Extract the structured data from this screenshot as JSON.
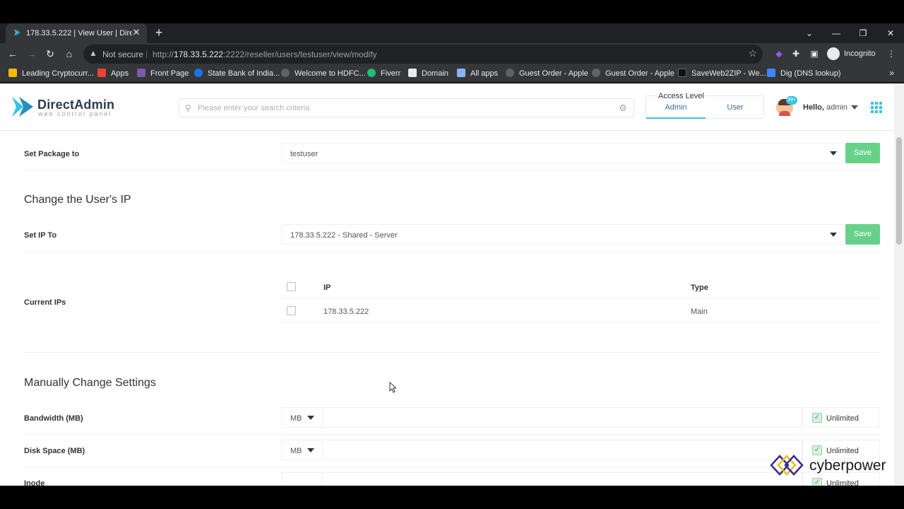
{
  "browser": {
    "tab_title": "178.33.5.222 | View User | DirectA",
    "url_host": "178.33.5.222",
    "url_prefix": "http://",
    "url_rest": ":2222/reseller/users/testuser/view/modify",
    "not_secure": "Not secure",
    "incognito": "Incognito",
    "bookmarks": [
      {
        "label": "Leading Cryptocurr...",
        "color": "#f0b90b"
      },
      {
        "label": "Apps",
        "color": "#ea4335"
      },
      {
        "label": "Front Page",
        "color": "#7a5ba8"
      },
      {
        "label": "State Bank of India...",
        "color": "#1a73e8"
      },
      {
        "label": "Welcome to HDFC...",
        "color": "#5f6368"
      },
      {
        "label": "Fiverr",
        "color": "#1dbf73"
      },
      {
        "label": "Domain",
        "color": "#e8eaed"
      },
      {
        "label": "All apps",
        "color": "#8ab4f8"
      },
      {
        "label": "Guest Order - Apple",
        "color": "#5f6368"
      },
      {
        "label": "Guest Order - Apple",
        "color": "#5f6368"
      },
      {
        "label": "SaveWeb2ZIP - We...",
        "color": "#202124"
      },
      {
        "label": "Dig (DNS lookup)",
        "color": "#4285f4"
      }
    ]
  },
  "header": {
    "brand": "DirectAdmin",
    "brand_sub": "web control panel",
    "search_placeholder": "Please enter your search criteria",
    "access_level_title": "Access Level",
    "access_tabs": [
      "Admin",
      "User"
    ],
    "active_access": "Admin",
    "notification_count": "99+",
    "hello_prefix": "Hello,",
    "username": "admin",
    "accent_color": "#3ac3e1"
  },
  "package": {
    "label": "Set Package to",
    "value": "testuser",
    "save_label": "Save"
  },
  "ip_section": {
    "heading": "Change the User's IP",
    "set_ip_label": "Set IP To",
    "set_ip_value": "178.33.5.222 - Shared - Server",
    "save_label": "Save",
    "current_ips_label": "Current IPs",
    "columns": [
      "IP",
      "Type"
    ],
    "rows": [
      {
        "ip": "178.33.5.222",
        "type": "Main"
      }
    ]
  },
  "manual": {
    "heading": "Manually Change Settings",
    "unlimited_label": "Unlimited",
    "settings": [
      {
        "label": "Bandwidth (MB)",
        "unit": "MB",
        "unlimited": true
      },
      {
        "label": "Disk Space (MB)",
        "unit": "MB",
        "unlimited": true
      },
      {
        "label": "Inode",
        "unit": "",
        "unlimited": true
      }
    ]
  },
  "watermark": {
    "text": "cyberpower"
  }
}
